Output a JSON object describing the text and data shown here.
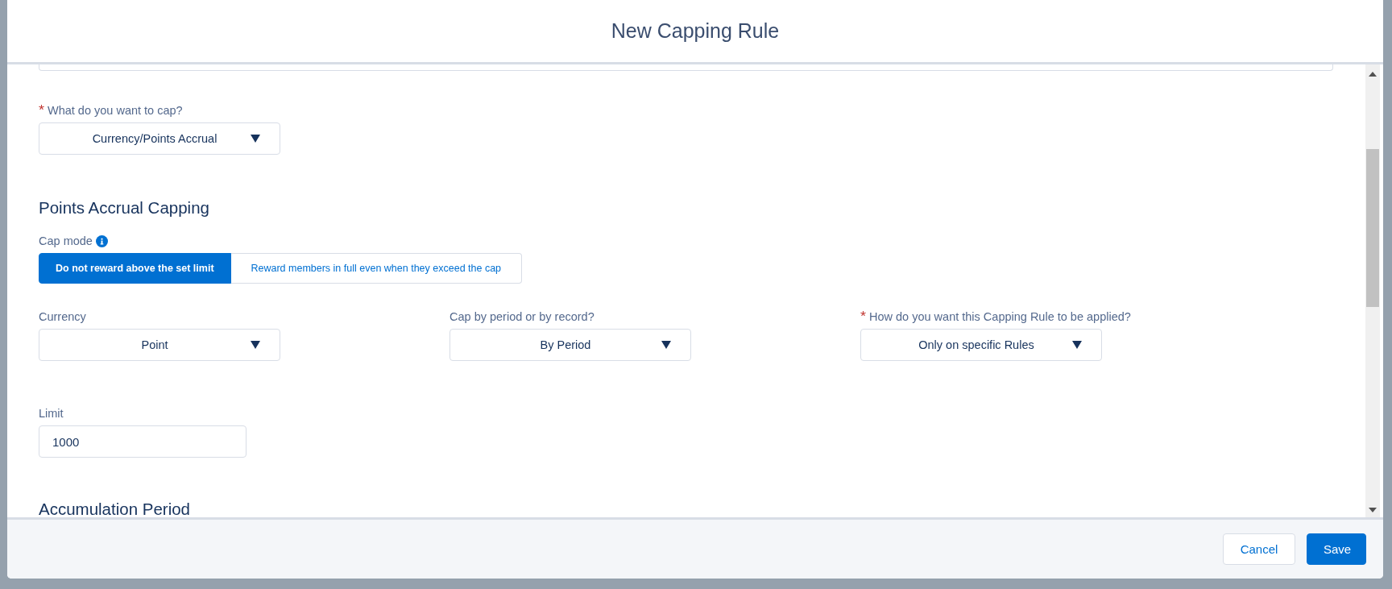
{
  "modal": {
    "title": "New Capping Rule"
  },
  "cap_target": {
    "label": "What do you want to cap?",
    "required": true,
    "value": "Currency/Points Accrual"
  },
  "section": {
    "heading": "Points Accrual Capping"
  },
  "cap_mode": {
    "label": "Cap mode",
    "options": [
      {
        "label": "Do not reward above the set limit",
        "selected": true
      },
      {
        "label": "Reward members in full even when they exceed the cap",
        "selected": false
      }
    ]
  },
  "selects": [
    {
      "label": "Currency",
      "required": false,
      "value": "Point"
    },
    {
      "label": "Cap by period or by record?",
      "required": false,
      "value": "By Period"
    },
    {
      "label": "How do you want this Capping Rule to be applied?",
      "required": true,
      "value": "Only on specific Rules"
    }
  ],
  "limit": {
    "label": "Limit",
    "value": "1000"
  },
  "next_section": {
    "heading": "Accumulation Period"
  },
  "footer": {
    "buttons": [
      {
        "label": "Cancel",
        "kind": "neutral"
      },
      {
        "label": "Save",
        "kind": "brand"
      }
    ]
  }
}
